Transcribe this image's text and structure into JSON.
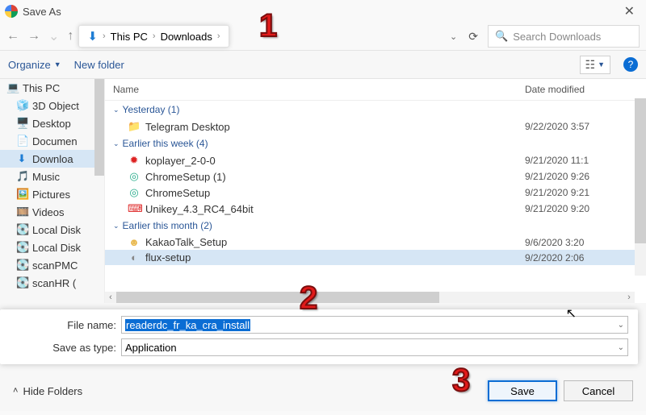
{
  "title": "Save As",
  "close": "✕",
  "nav": {
    "back": "←",
    "fwd": "→",
    "up": "↑"
  },
  "breadcrumb": {
    "loc1": "This PC",
    "loc2": "Downloads"
  },
  "addr_chev": "⌄",
  "refresh": "⟳",
  "search": {
    "icon": "🔍",
    "placeholder": "Search Downloads"
  },
  "toolbar": {
    "organize": "Organize",
    "newfolder": "New folder",
    "view": "☷",
    "help": "?"
  },
  "tree": [
    {
      "icon": "💻",
      "label": "This PC",
      "root": true
    },
    {
      "icon": "🧊",
      "label": "3D Object",
      "c": "#2aa8d8"
    },
    {
      "icon": "🖥️",
      "label": "Desktop",
      "c": "#2aa8d8"
    },
    {
      "icon": "📄",
      "label": "Documen",
      "c": "#6aa8d8"
    },
    {
      "icon": "⬇",
      "label": "Downloa",
      "sel": true,
      "c": "#1e7dd4"
    },
    {
      "icon": "🎵",
      "label": "Music",
      "c": "#1e7dd4"
    },
    {
      "icon": "🖼️",
      "label": "Pictures",
      "c": "#2aa8d8"
    },
    {
      "icon": "🎞️",
      "label": "Videos",
      "c": "#666"
    },
    {
      "icon": "💽",
      "label": "Local Disk",
      "c": "#888"
    },
    {
      "icon": "💽",
      "label": "Local Disk",
      "c": "#888"
    },
    {
      "icon": "💽",
      "label": "scanPMC",
      "c": "#888"
    },
    {
      "icon": "💽",
      "label": "scanHR (",
      "c": "#888"
    }
  ],
  "cols": {
    "name": "Name",
    "date": "Date modified"
  },
  "groups": [
    {
      "title": "Yesterday (1)",
      "rows": [
        {
          "icon": "📁",
          "c": "#e8b84e",
          "name": "Telegram Desktop",
          "date": "9/22/2020 3:57"
        }
      ]
    },
    {
      "title": "Earlier this week (4)",
      "rows": [
        {
          "icon": "✹",
          "c": "#d22",
          "name": "koplayer_2-0-0",
          "date": "9/21/2020 11:1"
        },
        {
          "icon": "◎",
          "c": "#2a8",
          "name": "ChromeSetup (1)",
          "date": "9/21/2020 9:26"
        },
        {
          "icon": "◎",
          "c": "#2a8",
          "name": "ChromeSetup",
          "date": "9/21/2020 9:21"
        },
        {
          "icon": "⌨",
          "c": "#d22",
          "name": "Unikey_4.3_RC4_64bit",
          "date": "9/21/2020 9:20"
        }
      ]
    },
    {
      "title": "Earlier this month (2)",
      "rows": [
        {
          "icon": "☻",
          "c": "#e8b84e",
          "name": "KakaoTalk_Setup",
          "date": "9/6/2020 3:20"
        },
        {
          "icon": "◐",
          "c": "#888",
          "name": "flux-setup",
          "date": "9/2/2020 2:06",
          "sel": true
        }
      ]
    }
  ],
  "filename_label": "File name:",
  "filename_value": "readerdc_fr_ka_cra_install",
  "type_label": "Save as type:",
  "type_value": "Application",
  "hide_label": "Hide Folders",
  "save_label": "Save",
  "cancel_label": "Cancel",
  "callouts": {
    "c1": "1",
    "c2": "2",
    "c3": "3"
  }
}
